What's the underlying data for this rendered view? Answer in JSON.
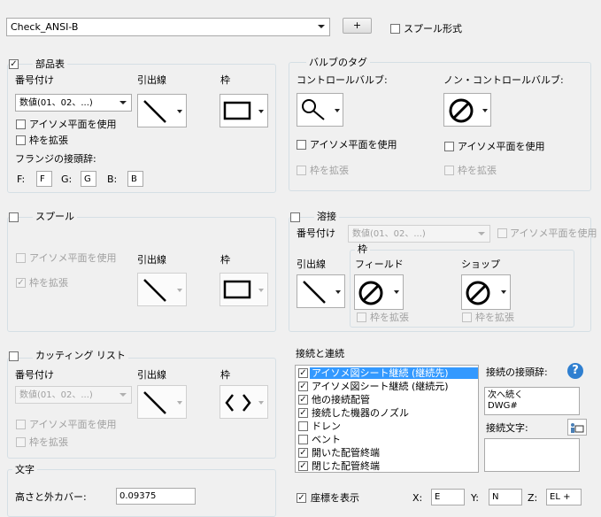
{
  "top": {
    "template_value": "Check_ANSI-B",
    "add_label": "+",
    "spool_format_label": "スプール形式"
  },
  "bom": {
    "title": "部品表",
    "checked": true,
    "numbering_label": "番号付け",
    "numbering_value": "数値(01、02、...)",
    "leader_label": "引出線",
    "frame_label": "枠",
    "iso_plane_label": "アイソメ平面を使用",
    "extend_frame_label": "枠を拡張",
    "flange_prefix_label": "フランジの接頭辞:",
    "f_label": "F:",
    "f_value": "F",
    "g_label": "G:",
    "g_value": "G",
    "b_label": "B:",
    "b_value": "B"
  },
  "valve_tag": {
    "title": "バルブのタグ",
    "control_label": "コントロールバルブ:",
    "noncontrol_label": "ノン・コントロールバルブ:",
    "iso_plane_label": "アイソメ平面を使用",
    "extend_frame_label": "枠を拡張"
  },
  "spool": {
    "title": "スプール",
    "iso_plane_label": "アイソメ平面を使用",
    "extend_frame_label": "枠を拡張",
    "leader_label": "引出線",
    "frame_label": "枠"
  },
  "weld": {
    "title": "溶接",
    "numbering_label": "番号付け",
    "numbering_value": "数値(01、02、...)",
    "iso_plane_label": "アイソメ平面を使用",
    "frame_label": "枠",
    "leader_label": "引出線",
    "field_label": "フィールド",
    "shop_label": "ショップ",
    "extend_frame_label": "枠を拡張"
  },
  "cutting": {
    "title": "カッティング リスト",
    "numbering_label": "番号付け",
    "numbering_value": "数値(01、02、...)",
    "leader_label": "引出線",
    "frame_label": "枠",
    "iso_plane_label": "アイソメ平面を使用",
    "extend_frame_label": "枠を拡張"
  },
  "text": {
    "title": "文字",
    "height_label": "高さと外カバー:",
    "height_value": "0.09375"
  },
  "connections": {
    "title": "接続と連続",
    "items": [
      {
        "label": "アイソメ図シート継続 (継続先)",
        "checked": true
      },
      {
        "label": "アイソメ図シート継続 (継続元)",
        "checked": true
      },
      {
        "label": "他の接続配管",
        "checked": true
      },
      {
        "label": "接続した機器のノズル",
        "checked": true
      },
      {
        "label": "ドレン",
        "checked": false
      },
      {
        "label": "ベント",
        "checked": false
      },
      {
        "label": "開いた配管終端",
        "checked": true
      },
      {
        "label": "閉じた配管終端",
        "checked": true
      }
    ],
    "prefix_label": "接続の接頭辞:",
    "prefix_value_line1": "次へ続く",
    "prefix_value_line2": "DWG#",
    "conn_text_label": "接続文字:",
    "show_coords_label": "座標を表示",
    "x_label": "X:",
    "x_value": "E",
    "y_label": "Y:",
    "y_value": "N",
    "z_label": "Z:",
    "z_value": "EL +"
  },
  "icons": [
    "leader-diagonal-icon",
    "rectangle-frame-icon",
    "magnifier-icon",
    "no-symbol-icon",
    "angle-brackets-icon",
    "help-icon",
    "edit-text-icon"
  ],
  "colors": {
    "selection": "#3399ff",
    "help": "#2f7fd0",
    "background": "#f0f0f0"
  }
}
